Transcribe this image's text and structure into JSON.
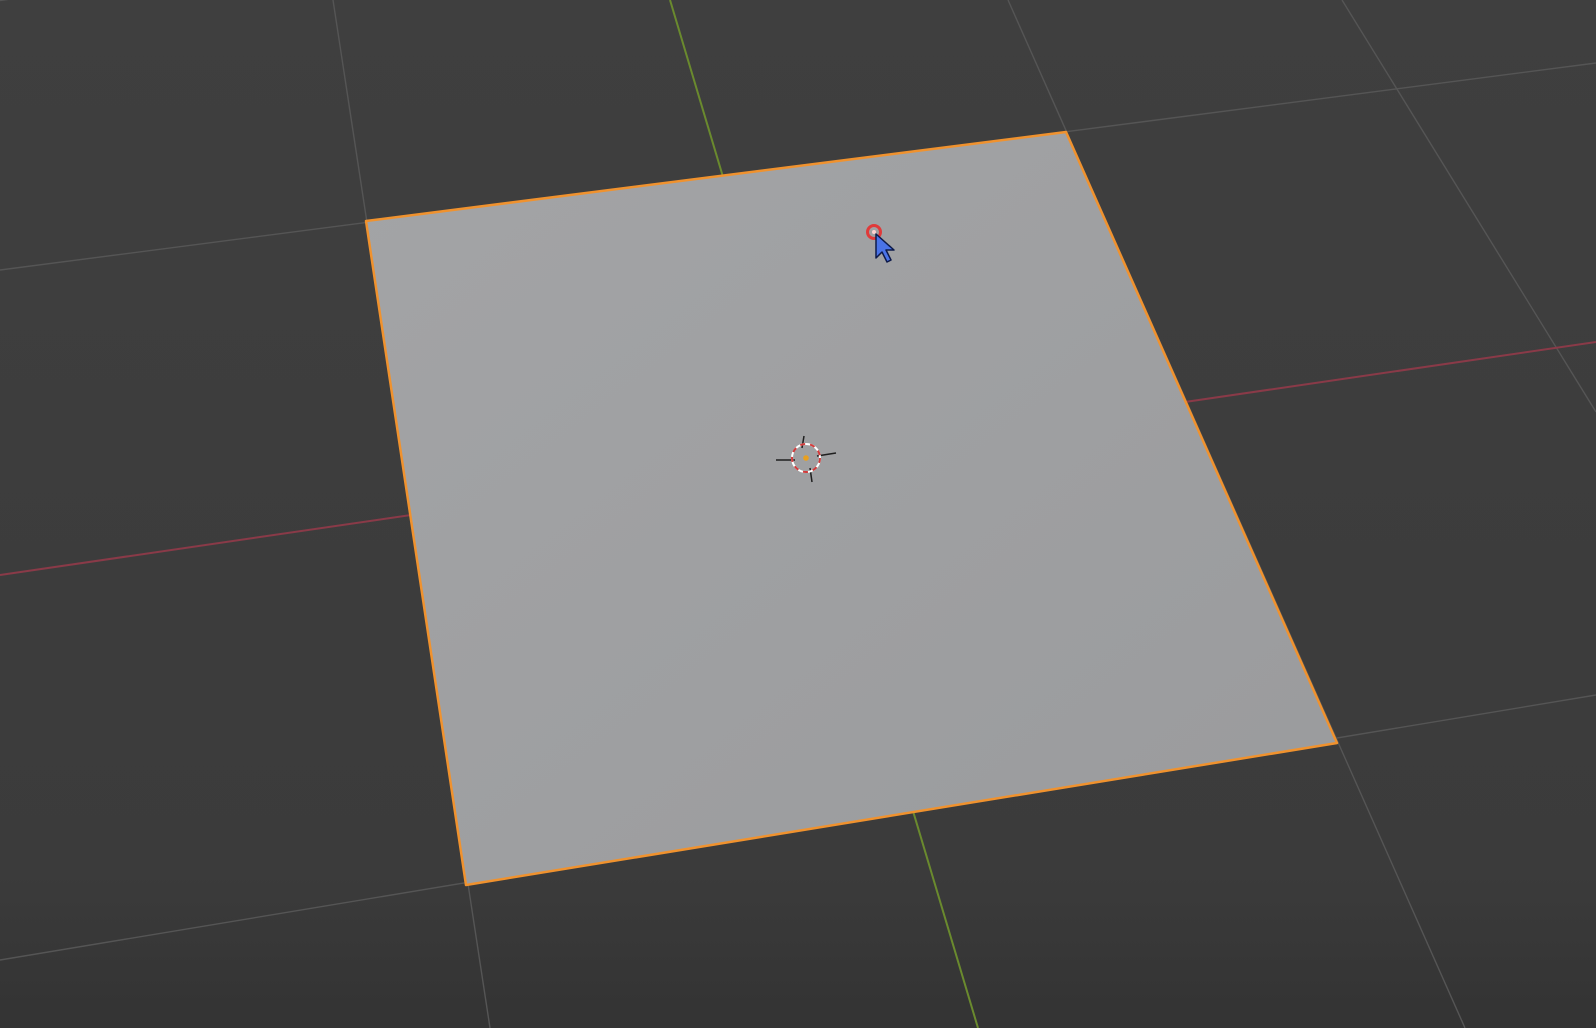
{
  "viewport": {
    "view": "3d-viewport",
    "background_color": "#3d3d3d",
    "grid_color": "#4a4a4a",
    "x_axis_color": "#8a3a48",
    "y_axis_color": "#6a8a2e"
  },
  "selected_object": {
    "type": "plane",
    "face_color": "#9fa0a2",
    "outline_color": "#f0922e",
    "selected": true
  },
  "cursor_3d": {
    "icon": "3d-cursor-icon",
    "ring_colors": [
      "#ffffff",
      "#d23c3c"
    ]
  },
  "mouse_pointer": {
    "icon": "mouse-pointer-icon",
    "fill_color": "#4a73e8",
    "click_indicator_color": "#e03a3a"
  }
}
